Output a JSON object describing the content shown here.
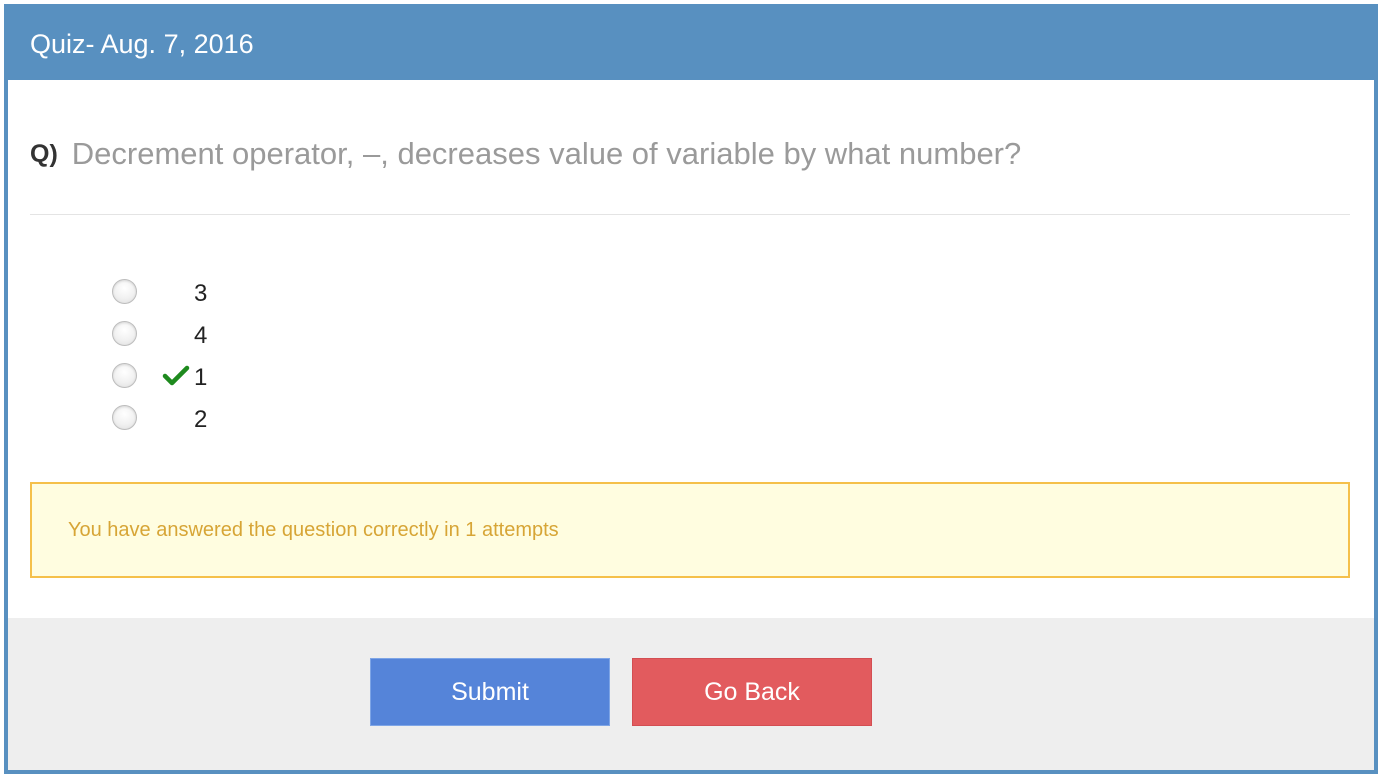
{
  "header": {
    "title": "Quiz- Aug. 7, 2016"
  },
  "question": {
    "label": "Q)",
    "text": "Decrement operator, –, decreases value of variable by what number?"
  },
  "options": [
    {
      "label": "3",
      "correct": false
    },
    {
      "label": "4",
      "correct": false
    },
    {
      "label": "1",
      "correct": true
    },
    {
      "label": "2",
      "correct": false
    }
  ],
  "alert": {
    "message": "You have answered the question correctly in 1 attempts"
  },
  "buttons": {
    "submit_label": "Submit",
    "back_label": "Go Back"
  },
  "colors": {
    "header_bg": "#5890c0",
    "submit_bg": "#5584d9",
    "back_bg": "#e25b5e",
    "alert_bg": "#fffde0",
    "alert_border": "#f5c04a",
    "alert_text": "#d7a536",
    "check": "#1e8a1e"
  }
}
